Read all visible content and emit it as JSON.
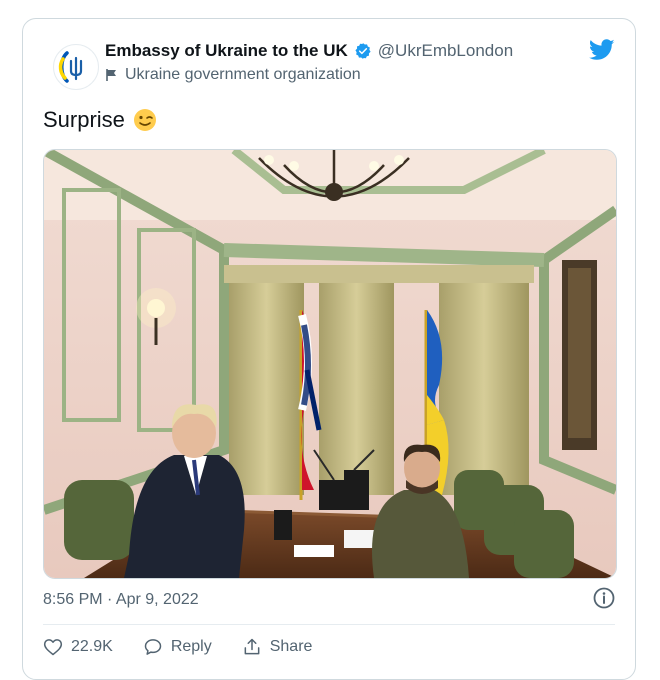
{
  "author": {
    "name": "Embassy of Ukraine to the UK",
    "handle": "@UkrEmbLondon",
    "org_label": "Ukraine government organization"
  },
  "tweet": {
    "text": "Surprise",
    "emoji": "winking-face",
    "timestamp": "8:56 PM · Apr 9, 2022"
  },
  "actions": {
    "likes": "22.9K",
    "reply_label": "Reply",
    "share_label": "Share"
  },
  "colors": {
    "twitter_blue": "#1d9bf0",
    "ukraine_blue": "#0057b7",
    "ukraine_yellow": "#ffd700"
  },
  "icons": [
    "twitter-bird-icon",
    "verified-badge-icon",
    "flag-icon",
    "info-icon",
    "heart-icon",
    "reply-icon",
    "share-icon"
  ]
}
